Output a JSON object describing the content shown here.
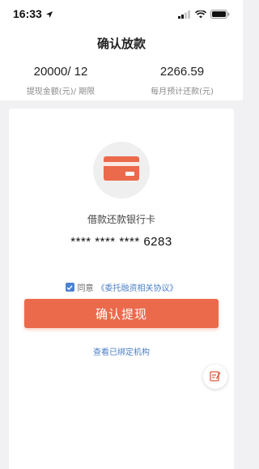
{
  "status_bar": {
    "time": "16:33",
    "icons": [
      "location-arrow-icon",
      "signal-icon",
      "wifi-icon",
      "battery-icon"
    ]
  },
  "header": {
    "title": "确认放款"
  },
  "summary": {
    "amount_term": "20000/ 12",
    "amount_term_label": "提现金额(元)/ 期限",
    "monthly_repay": "2266.59",
    "monthly_repay_label": "每月预计还款(元)"
  },
  "card": {
    "icon": "bank-card-icon",
    "label": "借款还款银行卡",
    "number": "**** **** **** 6283"
  },
  "agreement": {
    "checked": true,
    "prefix": "同意",
    "link": "《委托融资相关协议》"
  },
  "confirm_button": "确认提现",
  "view_link": "查看已绑定机构",
  "fab_icon": "edit-note-icon",
  "colors": {
    "accent": "#eb6a4c",
    "link": "#4a7fc8",
    "checkbox": "#4a82d4",
    "background": "#f1f1f3"
  }
}
